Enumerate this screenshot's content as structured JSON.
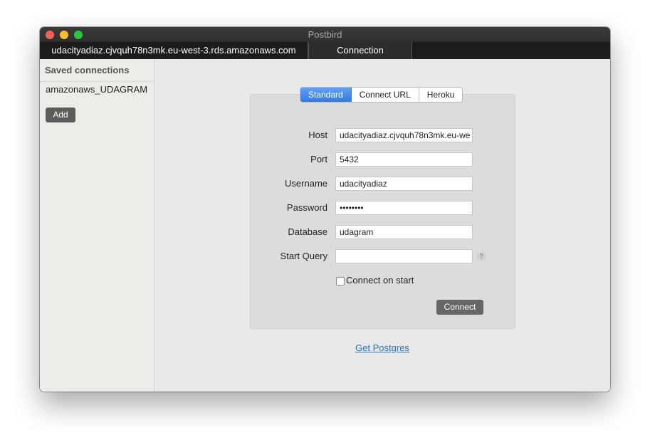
{
  "window": {
    "title": "Postbird"
  },
  "tabs": [
    {
      "label": "udacityadiaz.cjvquh78n3mk.eu-west-3.rds.amazonaws.com"
    },
    {
      "label": "Connection"
    }
  ],
  "sidebar": {
    "header": "Saved connections",
    "items": [
      {
        "label": "amazonaws_UDAGRAM"
      }
    ],
    "add_label": "Add"
  },
  "connection_types": [
    "Standard",
    "Connect URL",
    "Heroku"
  ],
  "active_connection_type": "Standard",
  "form": {
    "host": {
      "label": "Host",
      "value": "udacityadiaz.cjvquh78n3mk.eu-we"
    },
    "port": {
      "label": "Port",
      "value": "5432"
    },
    "username": {
      "label": "Username",
      "value": "udacityadiaz"
    },
    "password": {
      "label": "Password",
      "value": "••••••••"
    },
    "database": {
      "label": "Database",
      "value": "udagram"
    },
    "start_query": {
      "label": "Start Query",
      "value": "",
      "help": "?"
    },
    "connect_on_start": {
      "label": "Connect on start",
      "checked": false
    },
    "connect_label": "Connect"
  },
  "get_postgres_link": "Get Postgres"
}
